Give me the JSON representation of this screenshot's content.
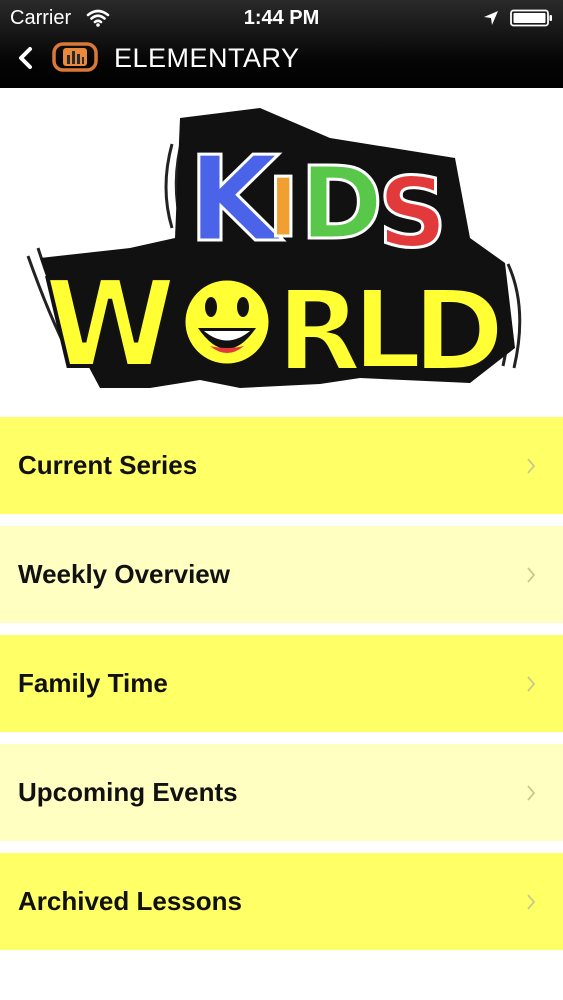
{
  "status_bar": {
    "carrier": "Carrier",
    "time": "1:44 PM",
    "icons": [
      "wifi-icon",
      "location-arrow-icon",
      "battery-icon"
    ]
  },
  "nav": {
    "back_icon": "chevron-left-icon",
    "logo_icon": "app-logo-icon",
    "title": "ELEMENTARY"
  },
  "banner": {
    "logo_line1": "KiDS",
    "logo_line2": "WORLD",
    "colors": {
      "yellow": "#ffff33",
      "blue": "#4a63e8",
      "orange": "#f0a030",
      "green": "#59c84a",
      "red": "#e23a3a"
    }
  },
  "menu": {
    "items": [
      {
        "label": "Current Series",
        "shade": "bright"
      },
      {
        "label": "Weekly Overview",
        "shade": "pale"
      },
      {
        "label": "Family Time",
        "shade": "bright"
      },
      {
        "label": "Upcoming Events",
        "shade": "pale"
      },
      {
        "label": "Archived Lessons",
        "shade": "bright"
      }
    ],
    "chevron_icon": "chevron-right-icon",
    "colors": {
      "bright": "#ffff66",
      "pale": "#ffffc2"
    }
  }
}
